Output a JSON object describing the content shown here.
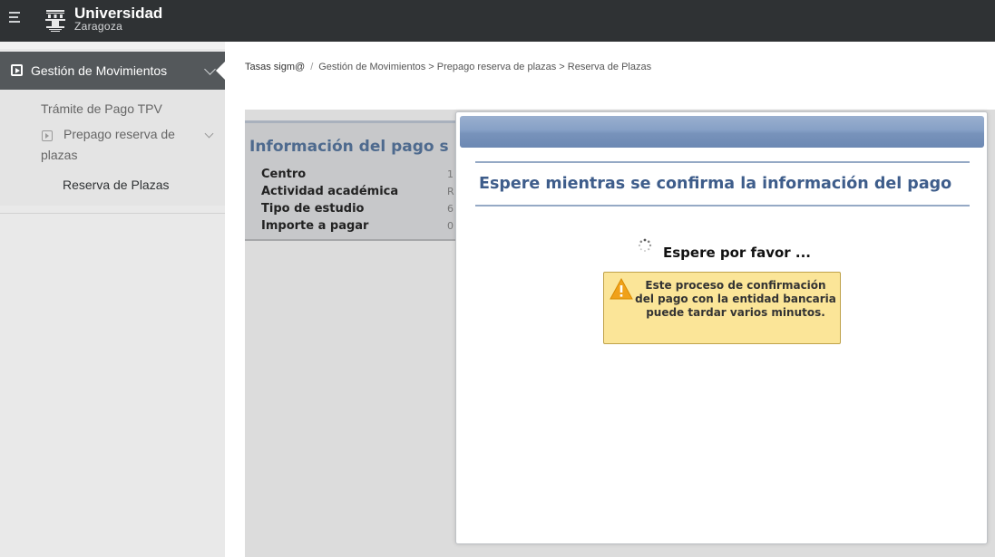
{
  "header": {
    "logo_title": "Universidad",
    "logo_subtitle": "Zaragoza"
  },
  "sidebar": {
    "section_label": "Gestión de Movimientos",
    "items": [
      {
        "label": "Trámite de Pago TPV"
      },
      {
        "label_line1": "Prepago reserva de",
        "label_line2": "plazas"
      },
      {
        "label": "Reserva de Plazas"
      }
    ]
  },
  "breadcrumb": {
    "root": "Tasas sigm@",
    "path": "Gestión de Movimientos > Prepago reserva de plazas > Reserva de Plazas"
  },
  "info_panel": {
    "title": "Información del pago s",
    "rows": [
      {
        "label": "Centro",
        "value": "1"
      },
      {
        "label": "Actividad académica",
        "value": "R"
      },
      {
        "label": "Tipo de estudio",
        "value": "6"
      },
      {
        "label": "Importe a pagar",
        "value": "0"
      }
    ]
  },
  "modal": {
    "title": "Espere mientras se confirma la información del pago",
    "wait_text": "Espere por favor ...",
    "warning_text": "Este proceso de confirmación del pago con la entidad bancaria puede tardar varios minutos."
  },
  "colors": {
    "topbar": "#2f3234",
    "sidebar_active": "#54585b",
    "modal_title": "#3e5d8b",
    "warning_bg": "#fbe598"
  }
}
